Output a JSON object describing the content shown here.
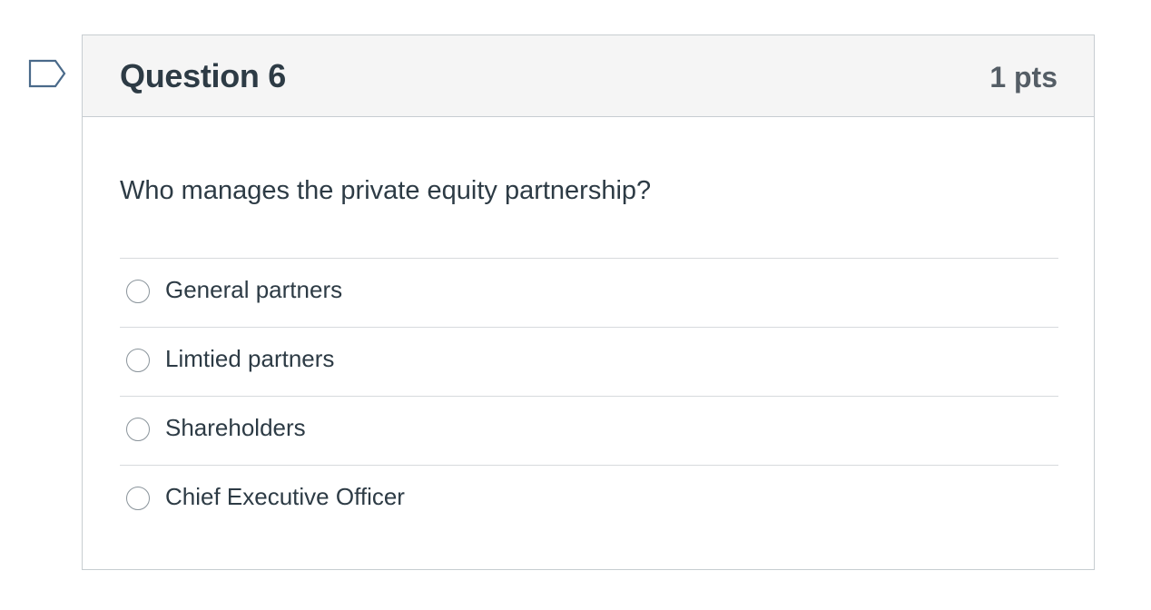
{
  "question": {
    "title": "Question 6",
    "points": "1 pts",
    "text": "Who manages the private equity partnership?",
    "answers": [
      {
        "label": "General partners",
        "selected": false
      },
      {
        "label": "Limtied partners",
        "selected": false
      },
      {
        "label": "Shareholders",
        "selected": false
      },
      {
        "label": "Chief Executive Officer",
        "selected": false
      }
    ]
  },
  "icons": {
    "flag": "flag-question-icon"
  },
  "colors": {
    "header_bg": "#f5f5f5",
    "border": "#c7cdd1",
    "text": "#2d3b45",
    "flag_stroke": "#4a6a8a"
  }
}
